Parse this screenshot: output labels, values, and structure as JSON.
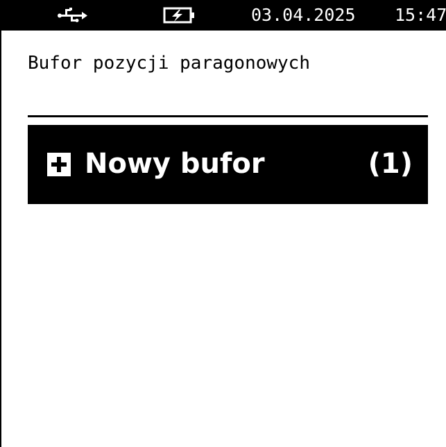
{
  "status_bar": {
    "usb_icon": "usb-icon",
    "battery_icon": "battery-charging-icon",
    "date": "03.04.2025",
    "time": "15:47"
  },
  "screen": {
    "title": "Bufor pozycji paragonowych"
  },
  "menu": {
    "items": [
      {
        "icon": "plus-box-icon",
        "label": "Nowy bufor",
        "count": "(1)",
        "selected": true
      }
    ]
  },
  "colors": {
    "background": "#ffffff",
    "foreground": "#000000",
    "highlight_bg": "#000000",
    "highlight_fg": "#ffffff"
  }
}
